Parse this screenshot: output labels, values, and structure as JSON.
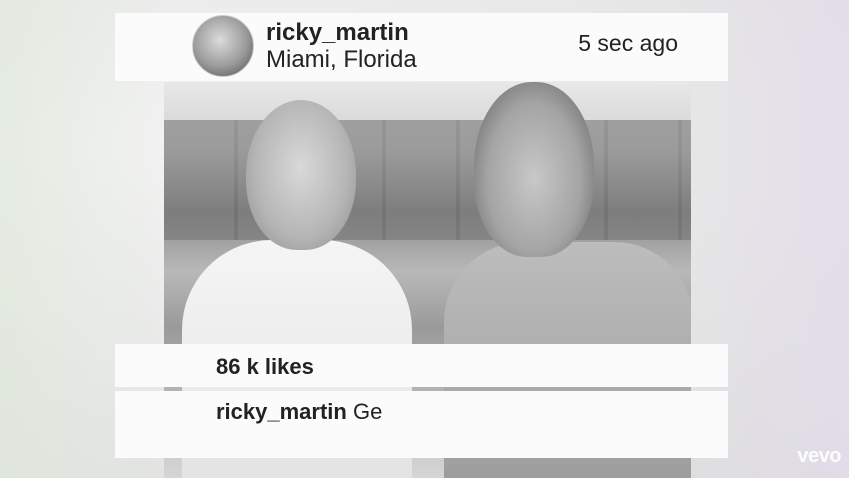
{
  "post": {
    "username": "ricky_martin",
    "location": "Miami, Florida",
    "time": "5 sec ago",
    "likes": "86 k likes",
    "caption": {
      "user": "ricky_martin",
      "text": "Ge"
    }
  },
  "watermark": "vevo",
  "icons": {
    "avatar": "profile-photo"
  }
}
